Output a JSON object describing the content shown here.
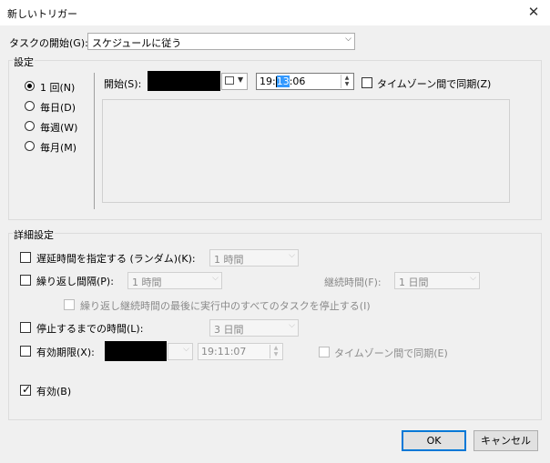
{
  "window": {
    "title": "新しいトリガー",
    "close_glyph": "✕"
  },
  "begin": {
    "label": "タスクの開始(G):",
    "value": "スケジュールに従う"
  },
  "settings": {
    "legend": "設定",
    "radios": [
      {
        "label": "1 回(N)",
        "selected": true
      },
      {
        "label": "毎日(D)",
        "selected": false
      },
      {
        "label": "毎週(W)",
        "selected": false
      },
      {
        "label": "毎月(M)",
        "selected": false
      }
    ],
    "start_label": "開始(S):",
    "time_pre": "19:",
    "time_sel": "13",
    "time_post": ":06",
    "tz_label": "タイムゾーン間で同期(Z)"
  },
  "advanced": {
    "legend": "詳細設定",
    "delay": {
      "label": "遅延時間を指定する (ランダム)(K):",
      "value": "1 時間"
    },
    "repeat": {
      "label": "繰り返し間隔(P):",
      "value": "1 時間",
      "duration_label": "継続時間(F):",
      "duration_value": "1 日間"
    },
    "stop_all": {
      "label": "繰り返し継続時間の最後に実行中のすべてのタスクを停止する(I)"
    },
    "stop_after": {
      "label": "停止するまでの時間(L):",
      "value": "3 日間"
    },
    "expire": {
      "label": "有効期限(X):",
      "time": "19:11:07",
      "tz_label": "タイムゾーン間で同期(E)"
    },
    "enabled": {
      "label": "有効(B)",
      "checked": true
    }
  },
  "buttons": {
    "ok": "OK",
    "cancel": "キャンセル"
  },
  "colors": {
    "accent": "#0078d7",
    "selection": "#3399ff"
  }
}
